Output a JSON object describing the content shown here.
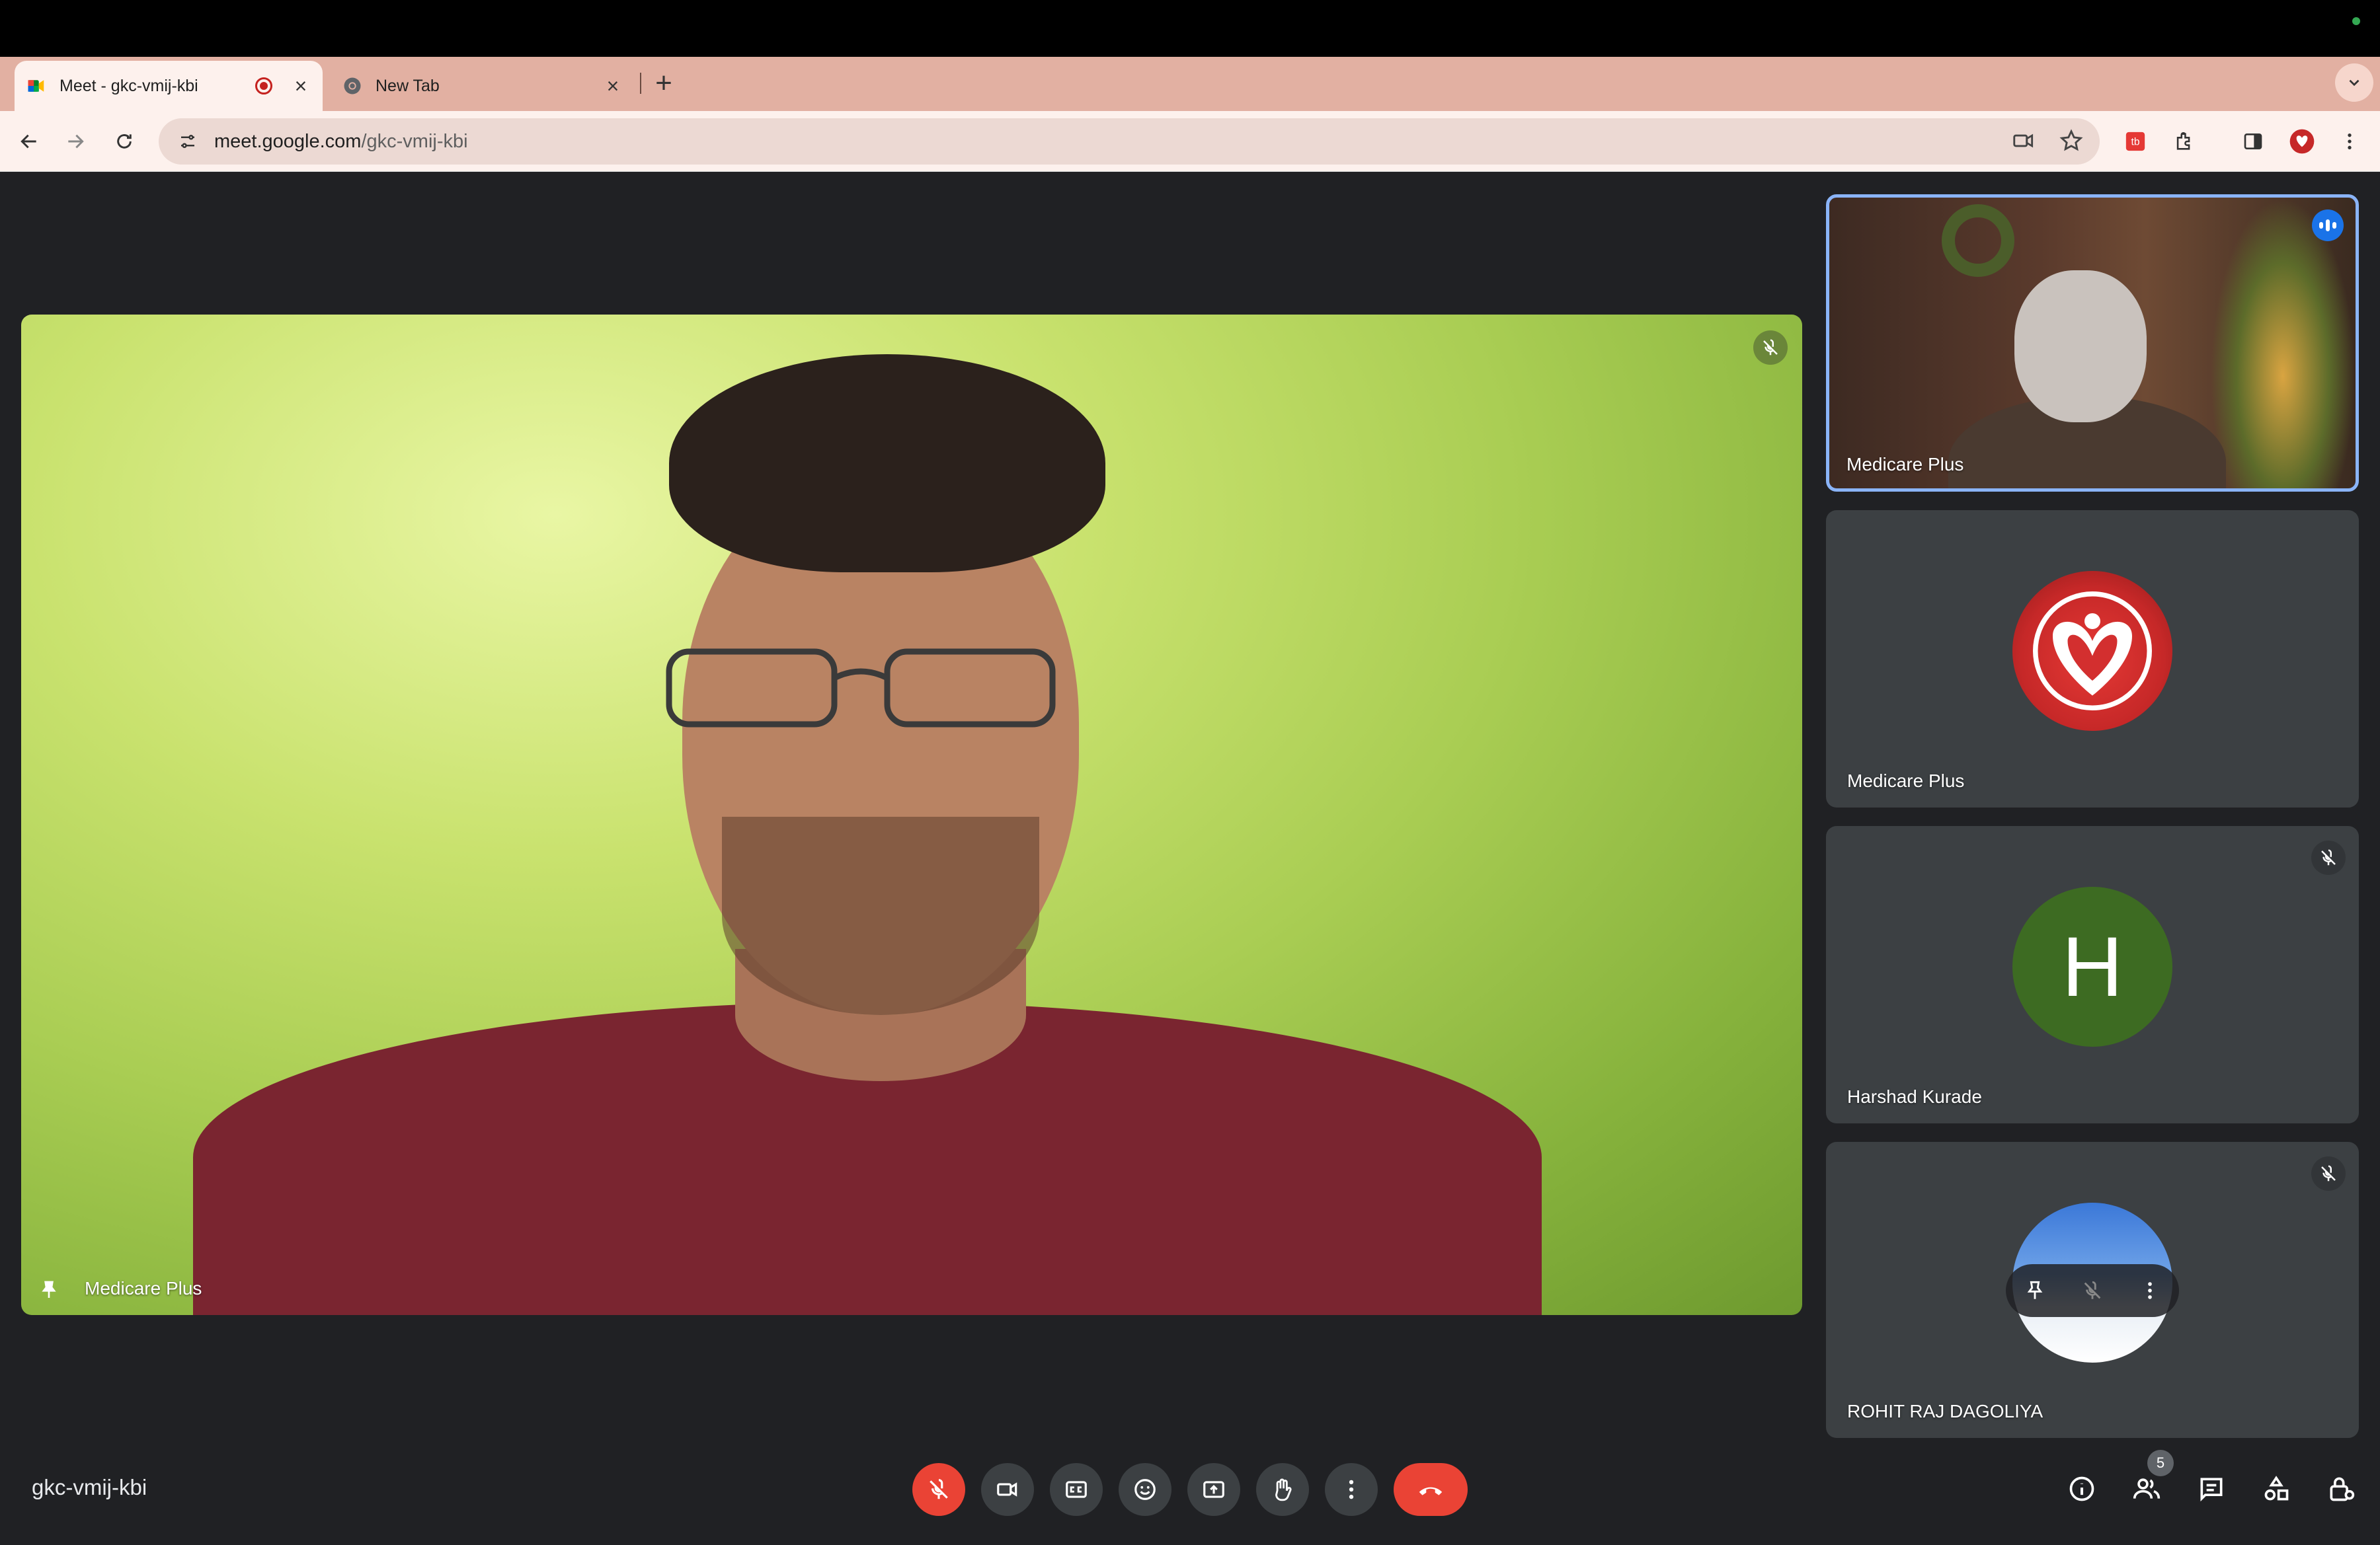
{
  "browser": {
    "tabs": [
      {
        "title": "Meet - gkc-vmij-kbi",
        "active": true
      },
      {
        "title": "New Tab",
        "active": false
      }
    ],
    "new_tab_symbol": "+",
    "close_symbol": "×",
    "url_host": "meet.google.com",
    "url_path": "/gkc-vmij-kbi"
  },
  "meeting": {
    "code": "gkc-vmij-kbi",
    "main_participant": {
      "name": "Medicare Plus",
      "muted": true,
      "pinned": true
    },
    "participants": [
      {
        "name": "Medicare Plus",
        "type": "video",
        "speaking": true
      },
      {
        "name": "Medicare Plus",
        "type": "logo-avatar"
      },
      {
        "name": "Harshad Kurade",
        "type": "letter-avatar",
        "initial": "H",
        "muted": true
      },
      {
        "name": "ROHIT RAJ DAGOLIYA",
        "type": "photo-avatar",
        "muted": true
      }
    ],
    "people_count": "5"
  },
  "colors": {
    "accent_blue": "#8ab4f8",
    "end_call_red": "#ea4335",
    "tab_strip": "#e2b0a2",
    "background": "#202124"
  },
  "controls": {
    "left": [
      "mic-off-icon",
      "camera-icon",
      "captions-icon",
      "emoji-icon",
      "present-icon",
      "raise-hand-icon",
      "more-options-icon",
      "end-call-icon"
    ],
    "right": [
      "info-icon",
      "people-icon",
      "chat-icon",
      "activities-icon",
      "host-controls-icon"
    ]
  }
}
